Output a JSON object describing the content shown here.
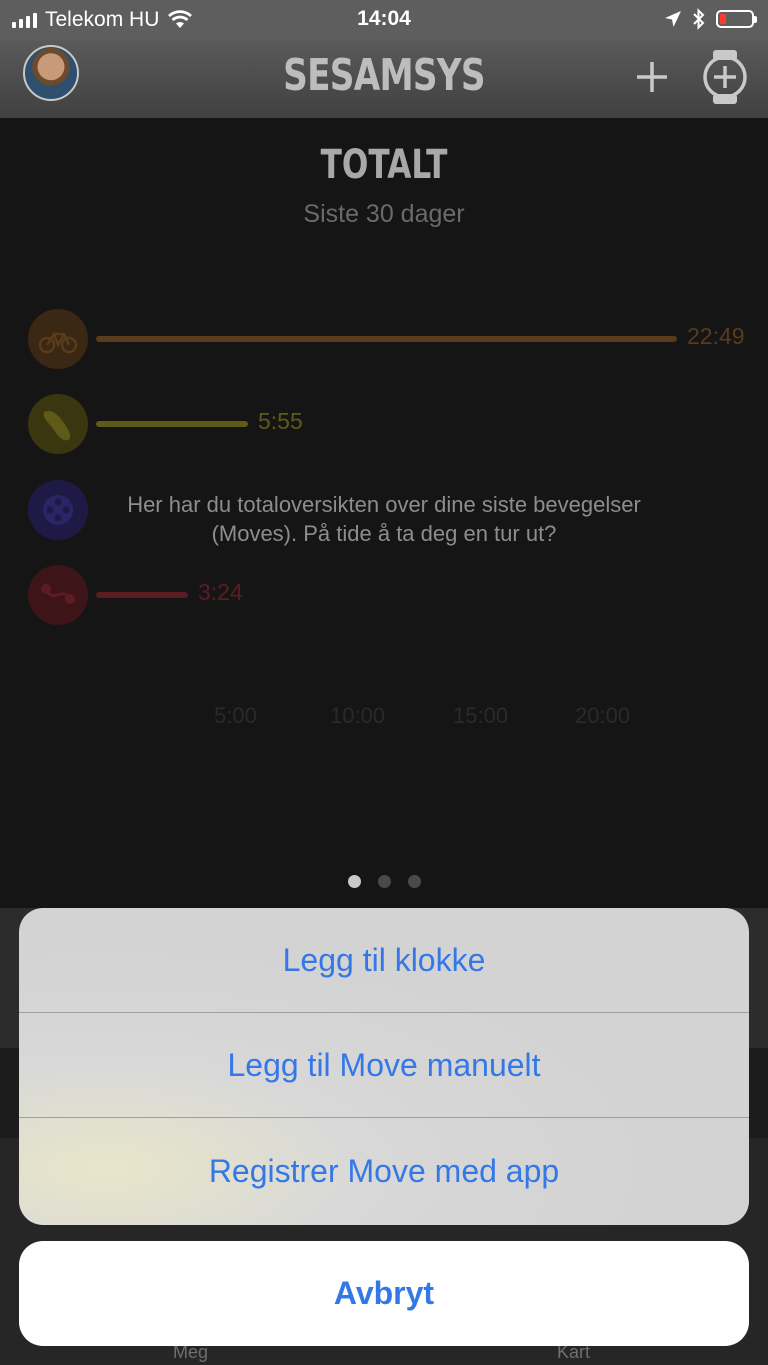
{
  "status_bar": {
    "carrier": "Telekom HU",
    "time": "14:04",
    "icons": [
      "signal-icon",
      "wifi-icon",
      "location-arrow-icon",
      "bluetooth-icon",
      "battery-icon"
    ],
    "battery_color": "#ff3b30"
  },
  "nav": {
    "brand": "SESAMSYS",
    "icons": [
      "avatar",
      "plus-icon",
      "add-watch-icon"
    ]
  },
  "main": {
    "title": "TOTALT",
    "subtitle": "Siste 30 dager",
    "activities": [
      {
        "icon": "bicycle-icon",
        "value": "22:49",
        "fraction": 0.88,
        "color": "#5a3b1b"
      },
      {
        "icon": "shoe-icon",
        "value": "5:55",
        "fraction": 0.23,
        "color": "#5f5a18"
      },
      {
        "icon": "film-reel-icon",
        "value": "",
        "fraction": 0.0,
        "color": "#2b2566"
      },
      {
        "icon": "route-icon",
        "value": "3:24",
        "fraction": 0.14,
        "color": "#5b1d22"
      }
    ],
    "tip": {
      "line1": "Her har du totaloversikten over dine siste bevegelser",
      "line2": "(Moves). På tide å ta deg en tur ut?"
    },
    "axis_labels": [
      "5:00",
      "10:00",
      "15:00",
      "20:00"
    ],
    "page_dots": 3,
    "active_dot": 0
  },
  "tabbar": {
    "left_label": "Meg",
    "right_label": "Kart"
  },
  "action_sheet": {
    "options": [
      "Legg til klokke",
      "Legg til Move manuelt",
      "Registrer Move med app"
    ],
    "cancel": "Avbryt",
    "accent": "#3478e8"
  }
}
